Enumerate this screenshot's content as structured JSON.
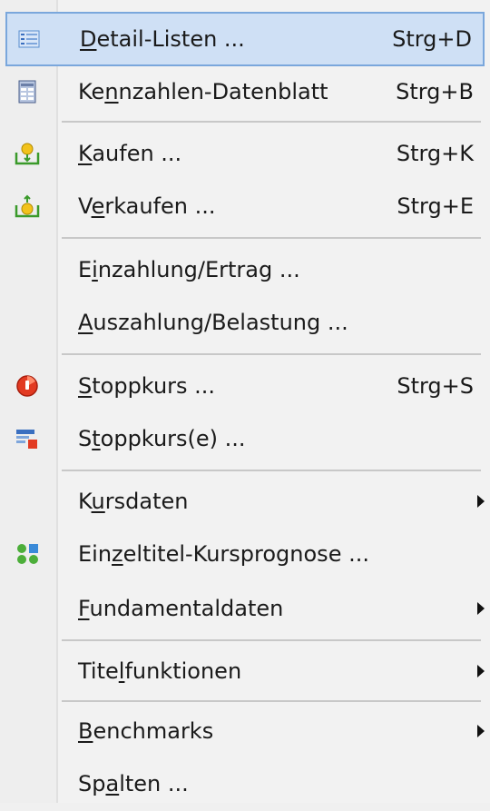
{
  "menu": {
    "items": [
      {
        "pre": "",
        "u": "D",
        "post": "etail-Listen ...",
        "shortcut": "Strg+D",
        "icon": "list-view-icon"
      },
      {
        "pre": "Ke",
        "u": "n",
        "post": "nzahlen-Datenblatt",
        "shortcut": "Strg+B",
        "icon": "datasheet-icon"
      },
      {
        "pre": "",
        "u": "K",
        "post": "aufen ...",
        "shortcut": "Strg+K",
        "icon": "buy-icon"
      },
      {
        "pre": "V",
        "u": "e",
        "post": "rkaufen ...",
        "shortcut": "Strg+E",
        "icon": "sell-icon"
      },
      {
        "pre": "E",
        "u": "i",
        "post": "nzahlung/Ertrag ...",
        "shortcut": "",
        "icon": ""
      },
      {
        "pre": "",
        "u": "A",
        "post": "uszahlung/Belastung ...",
        "shortcut": "",
        "icon": ""
      },
      {
        "pre": "",
        "u": "S",
        "post": "toppkurs ...",
        "shortcut": "Strg+S",
        "icon": "stop-icon"
      },
      {
        "pre": "S",
        "u": "t",
        "post": "oppkurs(e) ...",
        "shortcut": "",
        "icon": "stop-list-icon"
      },
      {
        "pre": "K",
        "u": "u",
        "post": "rsdaten",
        "shortcut": "",
        "icon": ""
      },
      {
        "pre": "Ein",
        "u": "z",
        "post": "eltitel-Kursprognose ...",
        "shortcut": "",
        "icon": "forecast-icon"
      },
      {
        "pre": "",
        "u": "F",
        "post": "undamentaldaten",
        "shortcut": "",
        "icon": ""
      },
      {
        "pre": "Tite",
        "u": "l",
        "post": "funktionen",
        "shortcut": "",
        "icon": ""
      },
      {
        "pre": "",
        "u": "B",
        "post": "enchmarks",
        "shortcut": "",
        "icon": ""
      },
      {
        "pre": "Sp",
        "u": "a",
        "post": "lten ...",
        "shortcut": "",
        "icon": ""
      }
    ]
  },
  "colors": {
    "highlight_bg": "#cfe0f5",
    "highlight_border": "#7aa7dc",
    "menu_bg": "#f2f2f2",
    "separator": "#c8c8c8"
  }
}
